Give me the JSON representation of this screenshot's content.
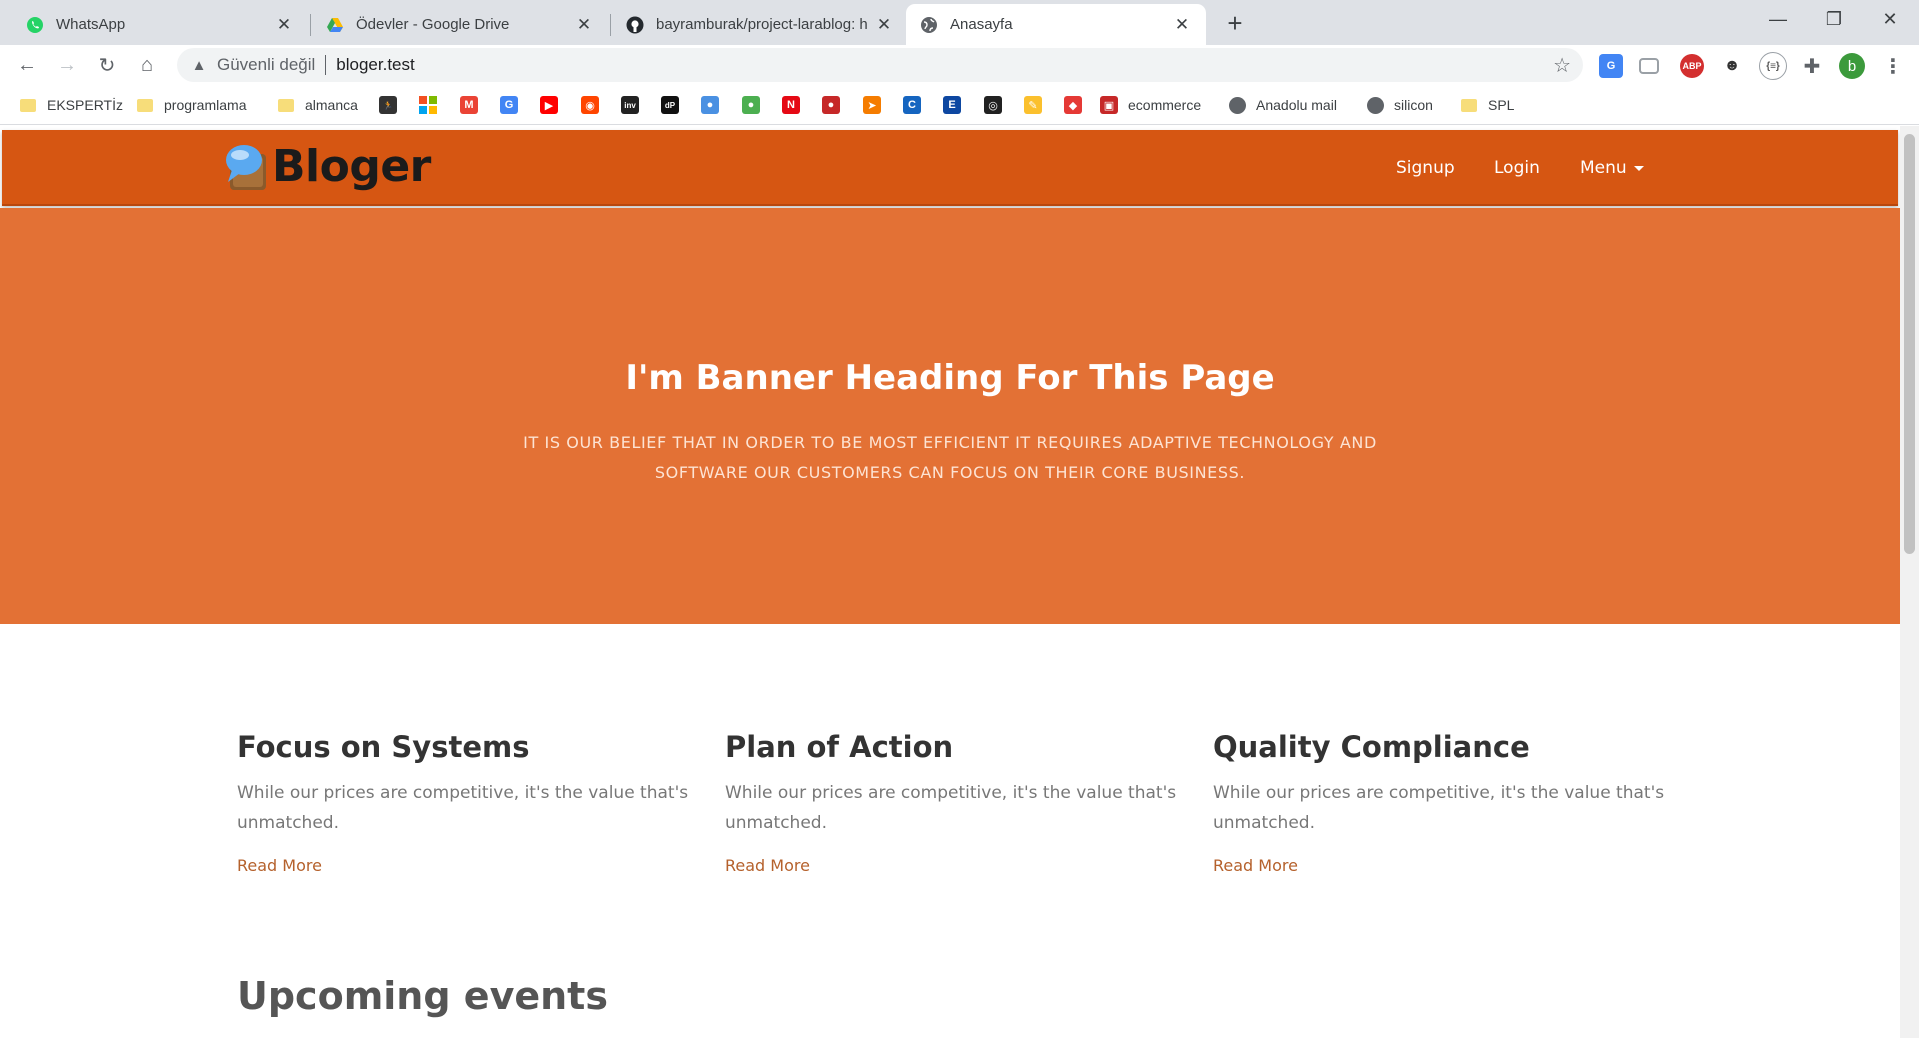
{
  "tabs": [
    {
      "title": "WhatsApp",
      "favicon": "whatsapp-icon",
      "active": false
    },
    {
      "title": "Ödevler - Google Drive",
      "favicon": "google-drive-icon",
      "active": false
    },
    {
      "title": "bayramburak/project-larablog: h",
      "favicon": "github-icon",
      "active": false
    },
    {
      "title": "Anasayfa",
      "favicon": "globe-icon",
      "active": true
    }
  ],
  "address_bar": {
    "security_label": "Güvenli değil",
    "url": "bloger.test"
  },
  "profile": {
    "initial": "b",
    "color": "#3c9a3c"
  },
  "extensions": {
    "abp_label": "ABP",
    "bracket_label": "{≡}"
  },
  "bookmarks": {
    "named": [
      {
        "label": "EKSPERTİz",
        "icon": "folder-icon"
      },
      {
        "label": "programlama",
        "icon": "folder-icon"
      },
      {
        "label": "almanca",
        "icon": "folder-icon"
      },
      {
        "label": "ecommerce",
        "icon": "ecommerce-icon"
      },
      {
        "label": "Anadolu mail",
        "icon": "globe-icon"
      },
      {
        "label": "silicon",
        "icon": "globe-icon"
      },
      {
        "label": "SPL",
        "icon": "folder-icon"
      }
    ],
    "icon_only": [
      {
        "name": "runner-icon",
        "color": "#333333",
        "glyph": "🏃"
      },
      {
        "name": "microsoft-icon",
        "color": "#f25022",
        "glyph": ""
      },
      {
        "name": "gmail-icon",
        "color": "#ea4335",
        "glyph": "M"
      },
      {
        "name": "google-translate-icon",
        "color": "#4285f4",
        "glyph": "G"
      },
      {
        "name": "youtube-icon",
        "color": "#ff0000",
        "glyph": "▶"
      },
      {
        "name": "reddit-icon",
        "color": "#ff4500",
        "glyph": "◉"
      },
      {
        "name": "investing-icon",
        "color": "#222222",
        "glyph": "inv"
      },
      {
        "name": "dp-icon",
        "color": "#111111",
        "glyph": "dP"
      },
      {
        "name": "drop-icon",
        "color": "#4a90e2",
        "glyph": "●"
      },
      {
        "name": "leaf-icon",
        "color": "#4caf50",
        "glyph": "●"
      },
      {
        "name": "netflix-icon",
        "color": "#e50914",
        "glyph": "N"
      },
      {
        "name": "red-circle-icon",
        "color": "#c62828",
        "glyph": "●"
      },
      {
        "name": "paper-plane-icon",
        "color": "#f57c00",
        "glyph": "➤"
      },
      {
        "name": "c-icon",
        "color": "#1565c0",
        "glyph": "C"
      },
      {
        "name": "e-icon",
        "color": "#0d47a1",
        "glyph": "E"
      },
      {
        "name": "fingerprint-icon",
        "color": "#212121",
        "glyph": "◎"
      },
      {
        "name": "pencil-icon",
        "color": "#fbc02d",
        "glyph": "✎"
      },
      {
        "name": "diamond-icon",
        "color": "#e53935",
        "glyph": "◆"
      }
    ]
  },
  "site": {
    "logo_text": "Bloger",
    "nav": {
      "signup": "Signup",
      "login": "Login",
      "menu": "Menu"
    },
    "banner": {
      "heading": "I'm Banner Heading For This Page",
      "subtext": "It is our belief that in order to be most efficient it requires adaptive technology and software our customers can focus on their core business."
    },
    "features": [
      {
        "title": "Focus on Systems",
        "text": "While our prices are competitive, it's the value that's unmatched.",
        "link": "Read More"
      },
      {
        "title": "Plan of Action",
        "text": "While our prices are competitive, it's the value that's unmatched.",
        "link": "Read More"
      },
      {
        "title": "Quality Compliance",
        "text": "While our prices are competitive, it's the value that's unmatched.",
        "link": "Read More"
      }
    ],
    "events_heading": "Upcoming events"
  },
  "colors": {
    "nav_bg": "#d65612",
    "banner_bg": "#e37135",
    "link": "#b5612c"
  }
}
